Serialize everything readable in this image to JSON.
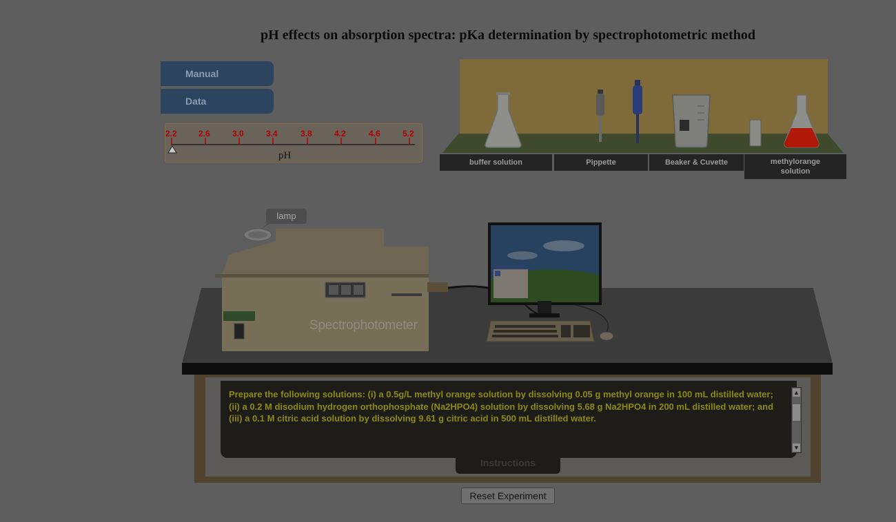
{
  "page": {
    "title": "pH effects on absorption spectra: pKa determination by spectrophotometric method"
  },
  "nav": {
    "manual_label": "Manual",
    "data_label": "Data"
  },
  "ph_slider": {
    "ticks": [
      "2.2",
      "2.6",
      "3.0",
      "3.4",
      "3.8",
      "4.2",
      "4.6",
      "5.2"
    ],
    "axis_label": "pH",
    "value": "2.2"
  },
  "shelf": {
    "labels": {
      "buffer": "buffer solution",
      "pippette": "Pippette",
      "beaker": "Beaker & Cuvette",
      "methylorange_line1": "methylorange",
      "methylorange_line2": "solution"
    }
  },
  "apparatus": {
    "lamp_label": "lamp",
    "spectro_label": "Spectrophotometer"
  },
  "instructions": {
    "text": "Prepare the following solutions: (i) a 0.5g/L methyl orange solution by dissolving 0.05 g methyl orange in 100 mL distilled water; (ii) a 0.2 M disodium hydrogen orthophosphate (Na2HPO4) solution by dissolving 5.68 g Na2HPO4 in 200 mL distilled water; and (iii) a 0.1 M citric acid solution by dissolving 9.61 g citric acid in 500 mL distilled water.",
    "tab_label": "Instructions"
  },
  "controls": {
    "reset_label": "Reset Experiment"
  },
  "colors": {
    "overlay_bg": "#5e5e5e",
    "nav_button": "#2c4460",
    "instruction_text": "#8c8a10",
    "tick_red": "#b00000",
    "methylorange": "#b01808"
  }
}
